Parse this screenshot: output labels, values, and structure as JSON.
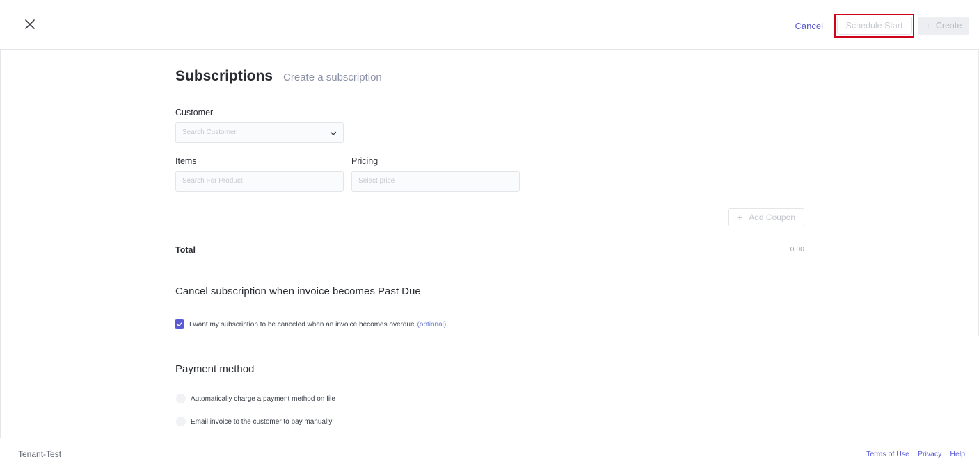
{
  "header": {
    "close_icon": "close-icon",
    "cancel_label": "Cancel",
    "schedule_label": "Schedule Start",
    "create_label": "Create",
    "highlight_color": "#d0021b"
  },
  "main": {
    "title": "Subscriptions",
    "subtitle": "Create a subscription",
    "customer": {
      "label": "Customer",
      "placeholder": "Search Customer"
    },
    "items": {
      "label": "Items",
      "placeholder": "Search For Product"
    },
    "pricing": {
      "label": "Pricing",
      "placeholder": "Select price"
    },
    "add_coupon_label": "Add Coupon",
    "total": {
      "label": "Total",
      "value": "0.00"
    },
    "cancel_section": {
      "heading": "Cancel subscription when invoice becomes Past Due",
      "checkbox_text": "I want my subscription to be canceled when an invoice becomes overdue",
      "optional_text": "(optional)",
      "checked": true
    },
    "payment_section": {
      "heading": "Payment method",
      "options": [
        "Automatically charge a payment method on file",
        "Email invoice to the customer to pay manually"
      ]
    }
  },
  "footer": {
    "tenant": "Tenant-Test",
    "links": [
      "Terms of Use",
      "Privacy",
      "Help"
    ]
  },
  "colors": {
    "accent": "#5a5bd4",
    "border": "#e3e5e8"
  }
}
